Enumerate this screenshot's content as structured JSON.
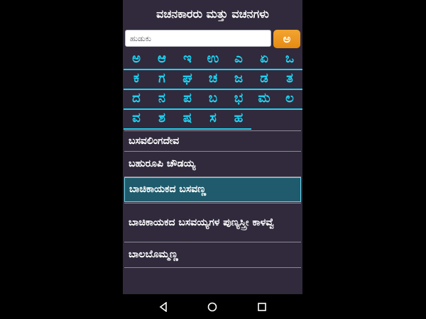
{
  "app_title": "ವಚನಕಾರರು ಮತ್ತು ವಚನಗಳು",
  "search": {
    "placeholder": "ಹುಡುಕು",
    "button_label": "ಅ"
  },
  "letters": [
    [
      "ಅ",
      "ಆ",
      "ಇ",
      "ಉ",
      "ಎ",
      "ಏ",
      "ಒ"
    ],
    [
      "ಕ",
      "ಗ",
      "ಘ",
      "ಚ",
      "ಜ",
      "ಡ",
      "ತ"
    ],
    [
      "ದ",
      "ನ",
      "ಪ",
      "ಬ",
      "ಭ",
      "ಮ",
      "ಲ"
    ],
    [
      "ವ",
      "ಶ",
      "ಷ",
      "ಸ",
      "ಹ"
    ]
  ],
  "list": [
    {
      "label": "ಬಸವಲಿಂಗದೇವ",
      "selected": false
    },
    {
      "label": "ಬಹುರೂಪಿ ಚೌಡಯ್ಯ",
      "selected": false
    },
    {
      "label": "ಬಾಚಿಕಾಯಕದ ಬಸವಣ್ಣ",
      "selected": true
    },
    {
      "label": "ಬಾಚಿಕಾಯಕದ ಬಸವಯ್ಯಗಳ ಪುಣ್ಯಸ್ತ್ರೀ ಕಾಳವ್ವೆ",
      "selected": false
    },
    {
      "label": "ಬಾಲಬೊಮ್ಮಣ್ಣ",
      "selected": false
    }
  ],
  "nav": {
    "icons": [
      "back-icon",
      "home-icon",
      "recents-icon"
    ]
  },
  "colors": {
    "background": "#302a3c",
    "letter": "#20d3f2",
    "selected_row": "#1f5b6c",
    "search_button": "#f39c1f"
  }
}
